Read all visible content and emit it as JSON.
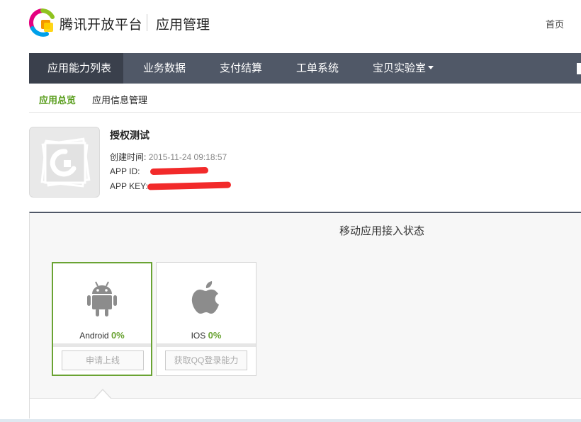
{
  "header": {
    "brand": "腾讯开放平台",
    "subtitle": "应用管理",
    "home": "首页"
  },
  "nav": {
    "items": [
      {
        "label": "应用能力列表",
        "has_dropdown": true,
        "active": true
      },
      {
        "label": "业务数据"
      },
      {
        "label": "支付结算"
      },
      {
        "label": "工单系统"
      },
      {
        "label": "宝贝实验室",
        "has_dropdown": true
      }
    ]
  },
  "subnav": {
    "items": [
      {
        "label": "应用总览",
        "active": true
      },
      {
        "label": "应用信息管理"
      }
    ]
  },
  "app": {
    "name": "授权测试",
    "created_label": "创建时间:",
    "created_value": "2015-11-24 09:18:57",
    "appid_label": "APP ID:",
    "appkey_label": "APP KEY:"
  },
  "status": {
    "title": "移动应用接入状态",
    "platforms": [
      {
        "name": "Android",
        "percent": "0%",
        "button": "申请上线",
        "icon": "android-icon",
        "selected": true
      },
      {
        "name": "IOS",
        "percent": "0%",
        "button": "获取QQ登录能力",
        "icon": "apple-icon"
      }
    ]
  },
  "colors": {
    "nav_bg": "#505867",
    "nav_active": "#3a404c",
    "accent_green": "#6aa333",
    "redaction": "#f22a2a"
  }
}
